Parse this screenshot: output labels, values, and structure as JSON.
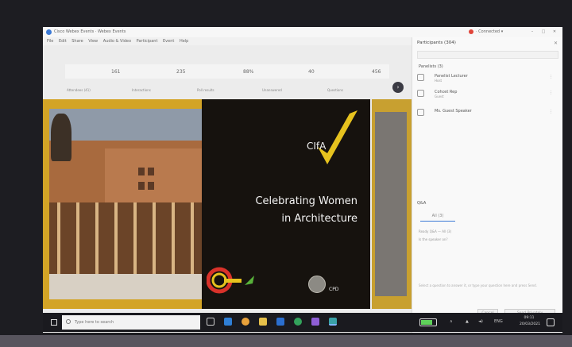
{
  "window": {
    "title": "Cisco Webex Events · Webex Events",
    "user": "· Connected ▾",
    "minimize": "–",
    "maximize": "□",
    "close": "✕"
  },
  "menu": [
    "File",
    "Edit",
    "Share",
    "View",
    "Audio & Video",
    "Participant",
    "Event",
    "Help"
  ],
  "stats": {
    "values": [
      "161",
      "235",
      "88%",
      "40",
      "456"
    ],
    "labels": [
      "Attendees (41)",
      "Interactions",
      "Poll results",
      "Unanswered",
      "Questions"
    ]
  },
  "slide": {
    "logo_text": "CIfA",
    "headline_line1": "Celebrating Women",
    "headline_line2": "in Architecture",
    "cpd_label": "CPD"
  },
  "participants": {
    "header": "Participants (304)",
    "close": "✕",
    "search_placeholder": "Search",
    "group_label": "Panelists (3)",
    "rows": [
      {
        "name": "Panelist Lecturer",
        "sub": "Host"
      },
      {
        "name": "Cohost Rep",
        "sub": "Guest"
      },
      {
        "name": "Ms. Guest Speaker",
        "sub": ""
      }
    ],
    "more": "⋮"
  },
  "qa": {
    "header": "Q&A",
    "tab": "All (3)",
    "line1": "Ready Q&A — All (3)",
    "line2": "Is the speaker on?",
    "note": "Select a question to answer it, or type your question here and press Send.",
    "btn_cancel": "Cancel",
    "btn_send": "Send Privately"
  },
  "taskbar": {
    "search_placeholder": "Type here to search",
    "clock_time": "09:11",
    "clock_date": "20/03/2021",
    "tray_up": "∧",
    "tray_net": "▲",
    "tray_vol": "◄)",
    "tray_lang": "ENG"
  }
}
